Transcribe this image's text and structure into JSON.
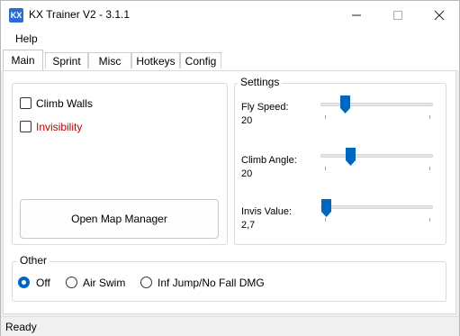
{
  "window": {
    "title": "KX Trainer V2 - 3.1.1",
    "icon_text": "KX"
  },
  "menu": {
    "items": [
      "Help"
    ]
  },
  "tabs": [
    "Main",
    "Sprint",
    "Misc",
    "Hotkeys",
    "Config"
  ],
  "active_tab": "Main",
  "main": {
    "checkboxes": [
      {
        "label": "Climb Walls",
        "checked": false,
        "color": "#000000"
      },
      {
        "label": "Invisibility",
        "checked": false,
        "color": "#c00000"
      }
    ],
    "open_map_button": "Open Map Manager"
  },
  "settings": {
    "title": "Settings",
    "sliders": [
      {
        "label": "Fly Speed:",
        "value": "20"
      },
      {
        "label": "Climb Angle:",
        "value": "20"
      },
      {
        "label": "Invis Value:",
        "value": "2,7"
      }
    ]
  },
  "other": {
    "title": "Other",
    "options": [
      {
        "label": "Off",
        "selected": true
      },
      {
        "label": "Air Swim",
        "selected": false
      },
      {
        "label": "Inf Jump/No Fall DMG",
        "selected": false
      }
    ]
  },
  "status": {
    "text": "Ready"
  },
  "colors": {
    "accent": "#0067c0",
    "icon_bg": "#2c6bd6"
  }
}
